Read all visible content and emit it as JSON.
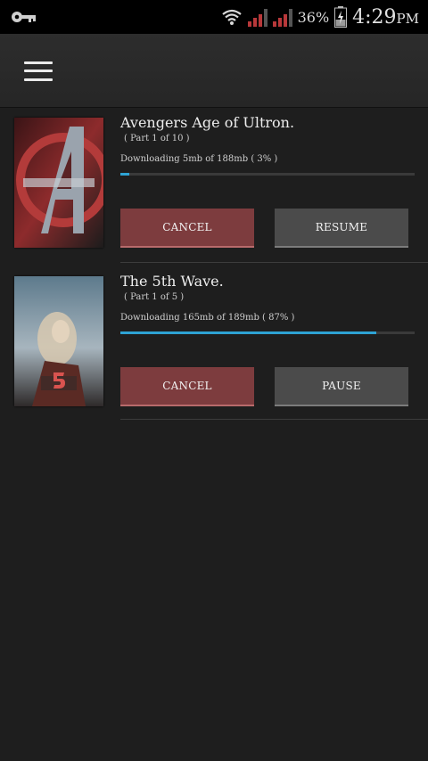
{
  "status_bar": {
    "battery_percent": "36%",
    "time": "4:29",
    "ampm": "PM",
    "icons": [
      "key-icon",
      "wifi-icon",
      "signal-icon",
      "battery-charging-icon"
    ]
  },
  "action_bar": {
    "menu_icon": "hamburger-menu-icon"
  },
  "downloads": [
    {
      "title": "Avengers Age of Ultron.",
      "part": "( Part 1 of 10 )",
      "status": "Downloading 5mb of 188mb  ( 3% )",
      "progress": 0.03,
      "cancel_label": "CANCEL",
      "action_label": "RESUME"
    },
    {
      "title": "The 5th Wave.",
      "part": "( Part 1 of 5 )",
      "status": "Downloading 165mb of 189mb  ( 87% )",
      "progress": 0.87,
      "cancel_label": "CANCEL",
      "action_label": "PAUSE"
    }
  ],
  "colors": {
    "progress": "#2ea3d4",
    "cancel": "#7d3c3e",
    "secondary": "#4b4b4b"
  }
}
